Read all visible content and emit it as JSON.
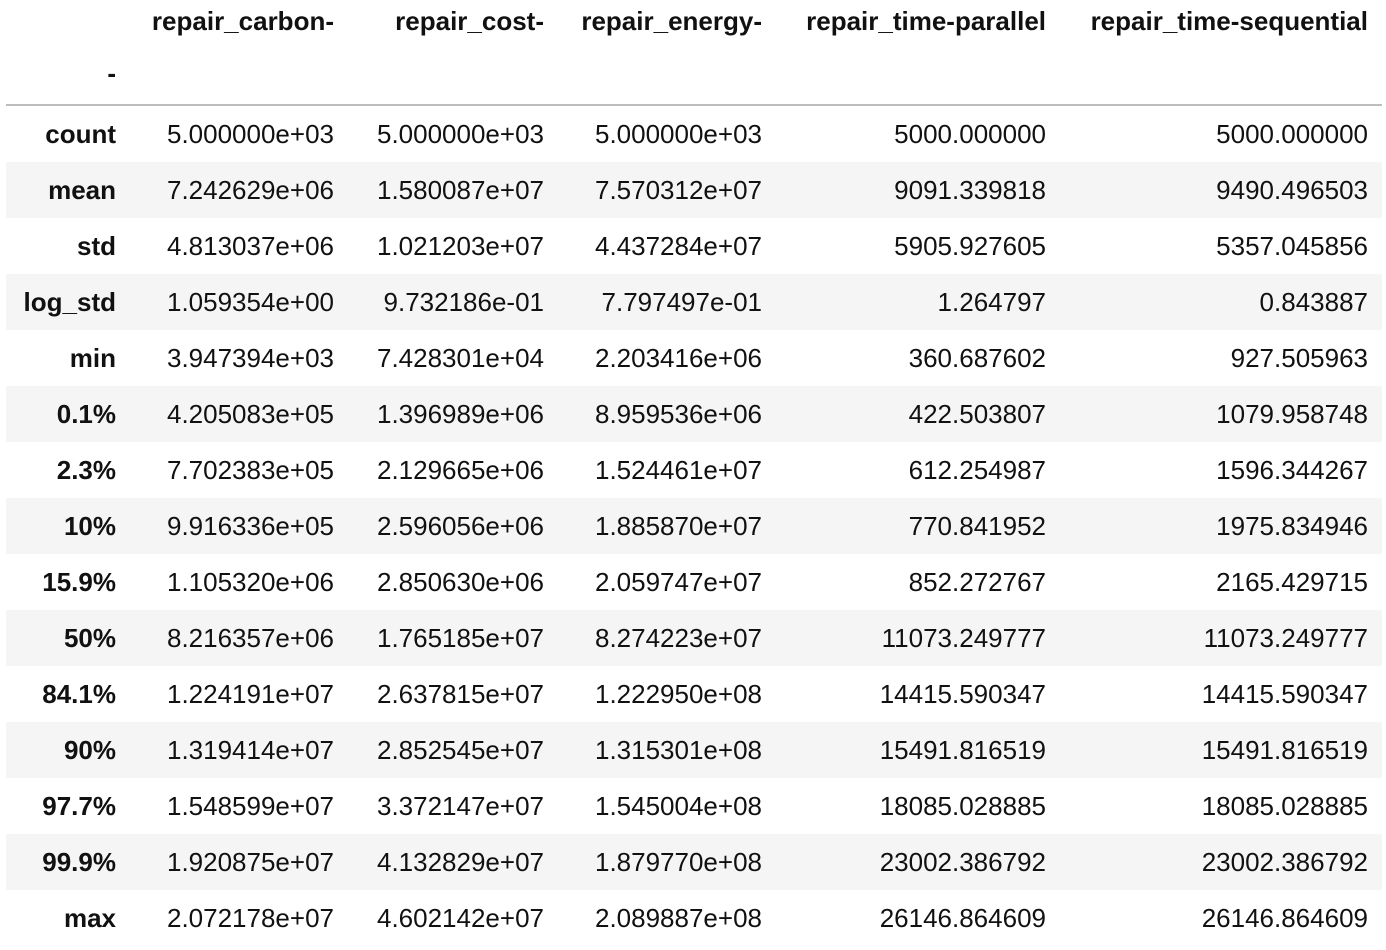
{
  "table": {
    "columns": [
      "repair_carbon-",
      "repair_cost-",
      "repair_energy-",
      "repair_time-parallel",
      "repair_time-sequential"
    ],
    "index_name": "-",
    "rows": [
      {
        "label": "count",
        "values": [
          "5.000000e+03",
          "5.000000e+03",
          "5.000000e+03",
          "5000.000000",
          "5000.000000"
        ]
      },
      {
        "label": "mean",
        "values": [
          "7.242629e+06",
          "1.580087e+07",
          "7.570312e+07",
          "9091.339818",
          "9490.496503"
        ]
      },
      {
        "label": "std",
        "values": [
          "4.813037e+06",
          "1.021203e+07",
          "4.437284e+07",
          "5905.927605",
          "5357.045856"
        ]
      },
      {
        "label": "log_std",
        "values": [
          "1.059354e+00",
          "9.732186e-01",
          "7.797497e-01",
          "1.264797",
          "0.843887"
        ]
      },
      {
        "label": "min",
        "values": [
          "3.947394e+03",
          "7.428301e+04",
          "2.203416e+06",
          "360.687602",
          "927.505963"
        ]
      },
      {
        "label": "0.1%",
        "values": [
          "4.205083e+05",
          "1.396989e+06",
          "8.959536e+06",
          "422.503807",
          "1079.958748"
        ]
      },
      {
        "label": "2.3%",
        "values": [
          "7.702383e+05",
          "2.129665e+06",
          "1.524461e+07",
          "612.254987",
          "1596.344267"
        ]
      },
      {
        "label": "10%",
        "values": [
          "9.916336e+05",
          "2.596056e+06",
          "1.885870e+07",
          "770.841952",
          "1975.834946"
        ]
      },
      {
        "label": "15.9%",
        "values": [
          "1.105320e+06",
          "2.850630e+06",
          "2.059747e+07",
          "852.272767",
          "2165.429715"
        ]
      },
      {
        "label": "50%",
        "values": [
          "8.216357e+06",
          "1.765185e+07",
          "8.274223e+07",
          "11073.249777",
          "11073.249777"
        ]
      },
      {
        "label": "84.1%",
        "values": [
          "1.224191e+07",
          "2.637815e+07",
          "1.222950e+08",
          "14415.590347",
          "14415.590347"
        ]
      },
      {
        "label": "90%",
        "values": [
          "1.319414e+07",
          "2.852545e+07",
          "1.315301e+08",
          "15491.816519",
          "15491.816519"
        ]
      },
      {
        "label": "97.7%",
        "values": [
          "1.548599e+07",
          "3.372147e+07",
          "1.545004e+08",
          "18085.028885",
          "18085.028885"
        ]
      },
      {
        "label": "99.9%",
        "values": [
          "1.920875e+07",
          "4.132829e+07",
          "1.879770e+08",
          "23002.386792",
          "23002.386792"
        ]
      },
      {
        "label": "max",
        "values": [
          "2.072178e+07",
          "4.602142e+07",
          "2.089887e+08",
          "26146.864609",
          "26146.864609"
        ]
      }
    ]
  }
}
